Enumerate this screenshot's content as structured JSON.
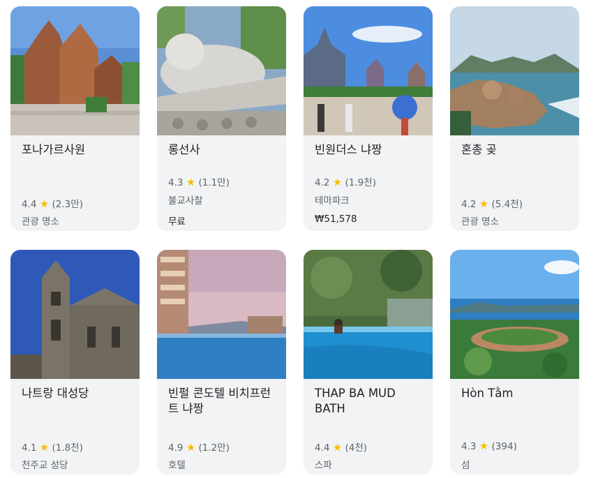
{
  "colors": {
    "card_bg": "#f1f3f4",
    "star": "#fbbc04",
    "meta": "#5f6368"
  },
  "places": [
    {
      "title": "포나가르사원",
      "rating": "4.4",
      "reviews": "(2.3만)",
      "category": "관광 명소",
      "price": ""
    },
    {
      "title": "롱선사",
      "rating": "4.3",
      "reviews": "(1.1만)",
      "category": "불교사찰",
      "price": "무료"
    },
    {
      "title": "빈원더스 냐짱",
      "rating": "4.2",
      "reviews": "(1.9천)",
      "category": "테마파크",
      "price": "₩51,578"
    },
    {
      "title": "혼총 곶",
      "rating": "4.2",
      "reviews": "(5.4천)",
      "category": "관광 명소",
      "price": ""
    },
    {
      "title": "나트랑 대성당",
      "rating": "4.1",
      "reviews": "(1.8천)",
      "category": "천주교 성당",
      "price": ""
    },
    {
      "title": "빈펄 콘도텔 비치프런트 냐짱",
      "rating": "4.9",
      "reviews": "(1.2만)",
      "category": "호텔",
      "price": ""
    },
    {
      "title": "THAP BA MUD BATH",
      "rating": "4.4",
      "reviews": "(4천)",
      "category": "스파",
      "price": ""
    },
    {
      "title": "Hòn Tằm",
      "rating": "4.3",
      "reviews": "(394)",
      "category": "섬",
      "price": ""
    }
  ]
}
